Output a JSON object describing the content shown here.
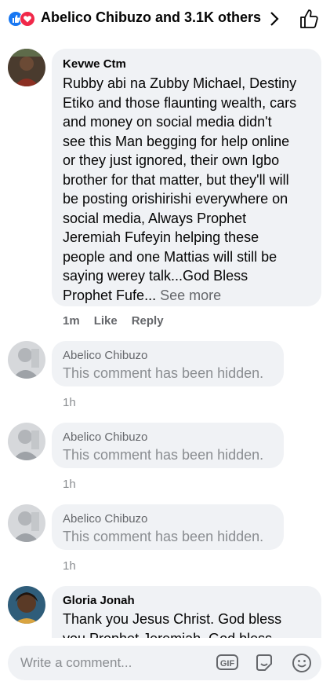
{
  "header": {
    "reaction_text": "Abelico Chibuzo and 3.1K others",
    "colors": {
      "like": "#1877f2",
      "love": "#f02849"
    }
  },
  "comments": [
    {
      "author": "Kevwe Ctm",
      "lines": [
        "Rubby abi na Zubby Michael, Destiny",
        "Etiko and those flaunting wealth, cars",
        "and money on social media didn't",
        "see this Man begging for help online",
        "or they just ignored, their own Igbo",
        "brother for that matter, but they'll will",
        "be posting orishirishi everywhere on",
        "social media, Always Prophet",
        "Jeremiah Fufeyin helping these",
        "people and one Mattias will still be",
        "saying werey talk...God Bless"
      ],
      "last_line": "Prophet Fufe...",
      "see_more": "See more",
      "time": "1m",
      "like": "Like",
      "reply": "Reply"
    },
    {
      "author": "Abelico Chibuzo",
      "text": "This comment has been hidden.",
      "time": "1h"
    },
    {
      "author": "Abelico Chibuzo",
      "text": "This comment has been hidden.",
      "time": "1h"
    },
    {
      "author": "Abelico Chibuzo",
      "text": "This comment has been hidden.",
      "time": "1h"
    },
    {
      "author": "Gloria Jonah",
      "line1": "Thank you Jesus Christ. God bless",
      "line2": "you Prophet Jeremiah. God bless"
    }
  ],
  "composer": {
    "placeholder": "Write a comment...",
    "gif_label": "GIF"
  },
  "icons": [
    "like-reaction-icon",
    "love-reaction-icon",
    "chevron-right-icon",
    "thumbs-up-icon",
    "gif-icon",
    "sticker-icon",
    "emoji-icon"
  ]
}
